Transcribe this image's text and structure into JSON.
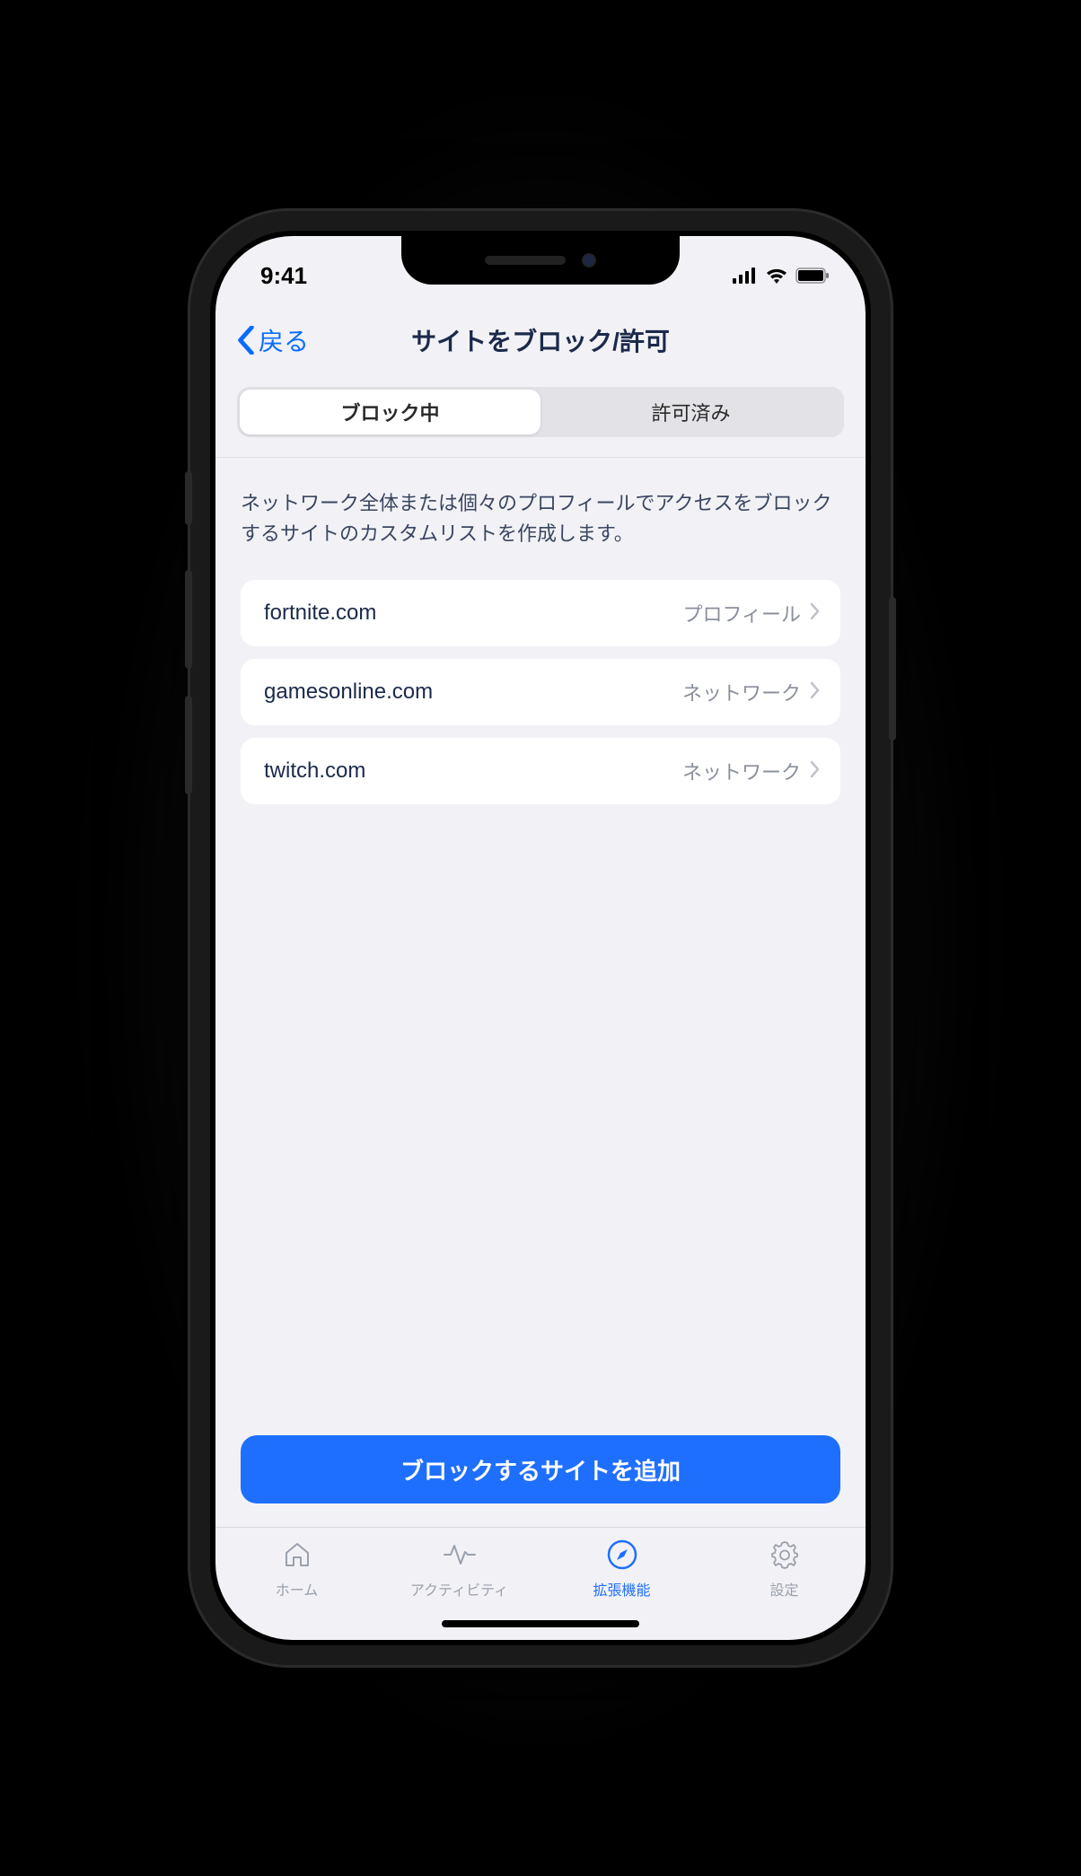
{
  "status": {
    "time": "9:41"
  },
  "nav": {
    "back": "戻る",
    "title": "サイトをブロック/許可"
  },
  "segmented": {
    "blocked": "ブロック中",
    "allowed": "許可済み"
  },
  "description": "ネットワーク全体または個々のプロフィールでアクセスをブロックするサイトのカスタムリストを作成します。",
  "sites": [
    {
      "domain": "fortnite.com",
      "scope": "プロフィール"
    },
    {
      "domain": "gamesonline.com",
      "scope": "ネットワーク"
    },
    {
      "domain": "twitch.com",
      "scope": "ネットワーク"
    }
  ],
  "add_button": "ブロックするサイトを追加",
  "tabs": {
    "home": "ホーム",
    "activity": "アクティビティ",
    "extensions": "拡張機能",
    "settings": "設定"
  }
}
